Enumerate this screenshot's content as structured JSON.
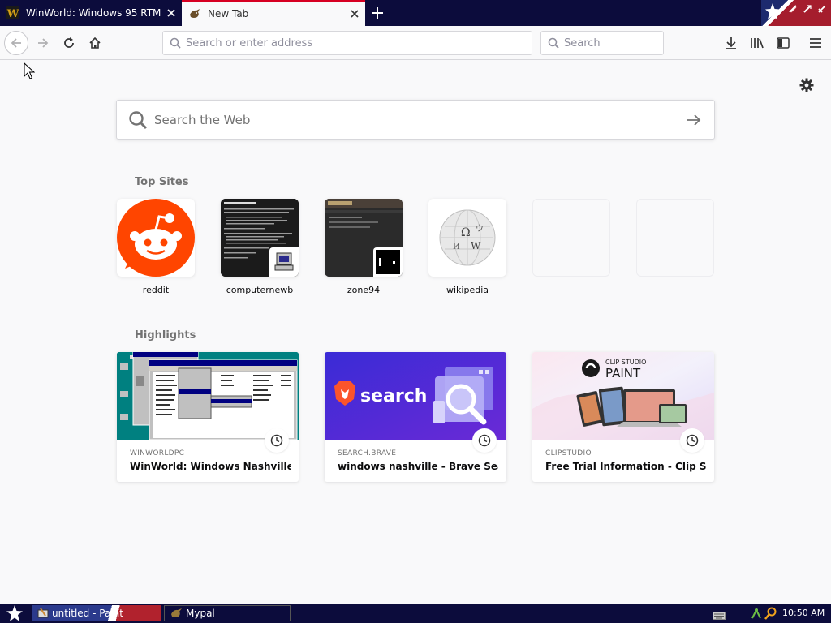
{
  "tabs": [
    {
      "title": "WinWorld: Windows 95 RTM",
      "favicon": "winworld-icon",
      "active": false
    },
    {
      "title": "New Tab",
      "favicon": "mypal-icon",
      "active": true
    }
  ],
  "navbar": {
    "address_placeholder": "Search or enter address",
    "address_value": "",
    "search_placeholder": "Search"
  },
  "newtab": {
    "web_search_placeholder": "Search the Web",
    "top_sites_heading": "Top Sites",
    "highlights_heading": "Highlights",
    "top_sites": [
      {
        "label": "reddit",
        "icon": "reddit-icon"
      },
      {
        "label": "computernewb",
        "icon": "computer-icon"
      },
      {
        "label": "zone94",
        "icon": "zone94-icon"
      },
      {
        "label": "wikipedia",
        "icon": "wikipedia-globe-icon"
      }
    ],
    "highlights": [
      {
        "source": "WINWORLDPC",
        "title": "WinWorld: Windows Nashville B..."
      },
      {
        "source": "SEARCH.BRAVE",
        "title": "windows nashville - Brave Search"
      },
      {
        "source": "CLIPSTUDIO",
        "title": "Free Trial Information - Clip Stu..."
      }
    ]
  },
  "thumbnails": {
    "brave_word": "search",
    "clip_studio_line1": "CLIP STUDIO",
    "clip_studio_line2": "PAINT"
  },
  "taskbar": {
    "buttons": [
      {
        "label": "untitled - Paint"
      },
      {
        "label": "Mypal"
      }
    ],
    "clock": "10:50 AM"
  },
  "colors": {
    "accent": "#d70022",
    "reddit": "#ff4500",
    "brave": "#fb542b",
    "taskbar": "#0c0c3c"
  }
}
